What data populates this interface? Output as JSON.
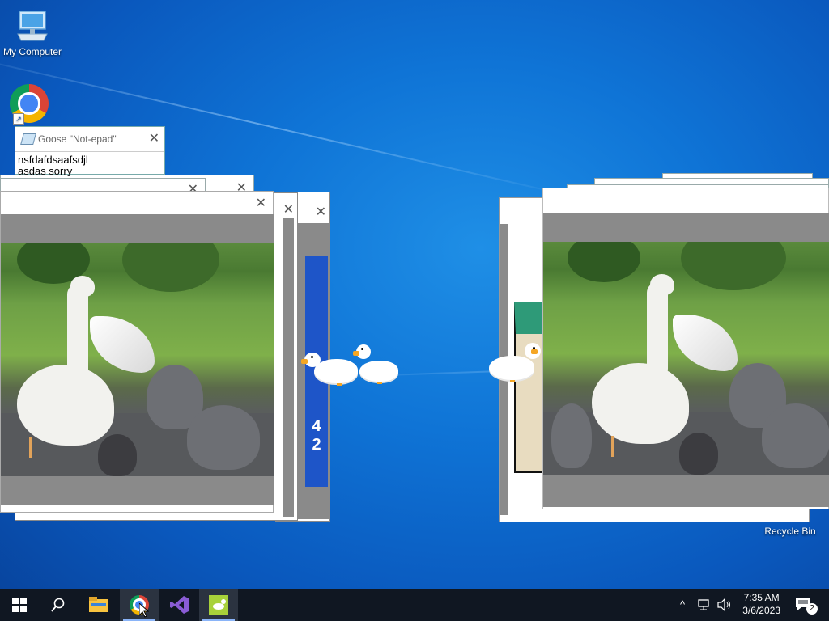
{
  "desktop": {
    "icons": [
      {
        "label": "My Computer"
      },
      {
        "label": ""
      },
      {
        "label": "Recycle Bin"
      }
    ]
  },
  "notepad": {
    "title": "Goose \"Not-epad\"",
    "content_line1": "nsfdafdsaafsdjl",
    "content_line2": "asdas      sorry"
  },
  "windows": {
    "close_glyph": "✕"
  },
  "taskbar": {
    "start_icon": "windows-logo-icon",
    "search_icon": "search-icon",
    "apps": [
      "file-explorer-icon",
      "chrome-icon",
      "visual-studio-icon",
      "desktop-goose-icon"
    ],
    "tray_up": "^",
    "time": "7:35 AM",
    "date": "3/6/2023",
    "notification_count": "2"
  },
  "colors": {
    "taskbar_bg": "#101722",
    "desktop_blue": "#0f74d6",
    "goose_beak": "#f5a623"
  }
}
